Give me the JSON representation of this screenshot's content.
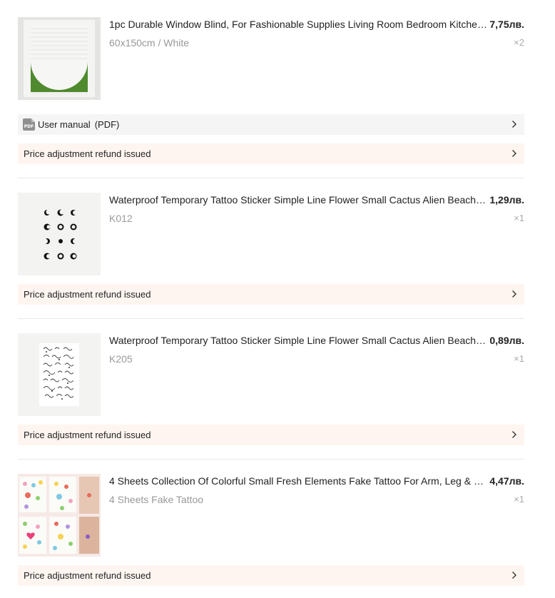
{
  "items": [
    {
      "title": "1pc Durable Window Blind, For Fashionable Supplies Living Room Bedroom Kitchen Office",
      "price": "7,75лв.",
      "variant": "60x150cm / White",
      "qty": "×2",
      "manual": {
        "label": "User manual",
        "suffix": "(PDF)",
        "icon": "PDF"
      },
      "refund": "Price adjustment refund issued"
    },
    {
      "title": "Waterproof Temporary Tattoo Sticker Simple Line Flower Small Cactus Alien Beach Tattoo",
      "price": "1,29лв.",
      "variant": "K012",
      "qty": "×1",
      "refund": "Price adjustment refund issued"
    },
    {
      "title": "Waterproof Temporary Tattoo Sticker Simple Line Flower Small Cactus Alien Beach Tattoo",
      "price": "0,89лв.",
      "variant": "K205",
      "qty": "×1",
      "refund": "Price adjustment refund issued"
    },
    {
      "title": "4 Sheets Collection Of Colorful Small Fresh Elements Fake Tattoo For Arm, Leg & Back",
      "price": "4,47лв.",
      "variant": "4 Sheets Fake Tattoo",
      "qty": "×1",
      "refund": "Price adjustment refund issued"
    }
  ],
  "colors": {
    "refund_bg": "#fff5f0",
    "manual_bg": "#f5f5f5",
    "muted": "#999999"
  }
}
